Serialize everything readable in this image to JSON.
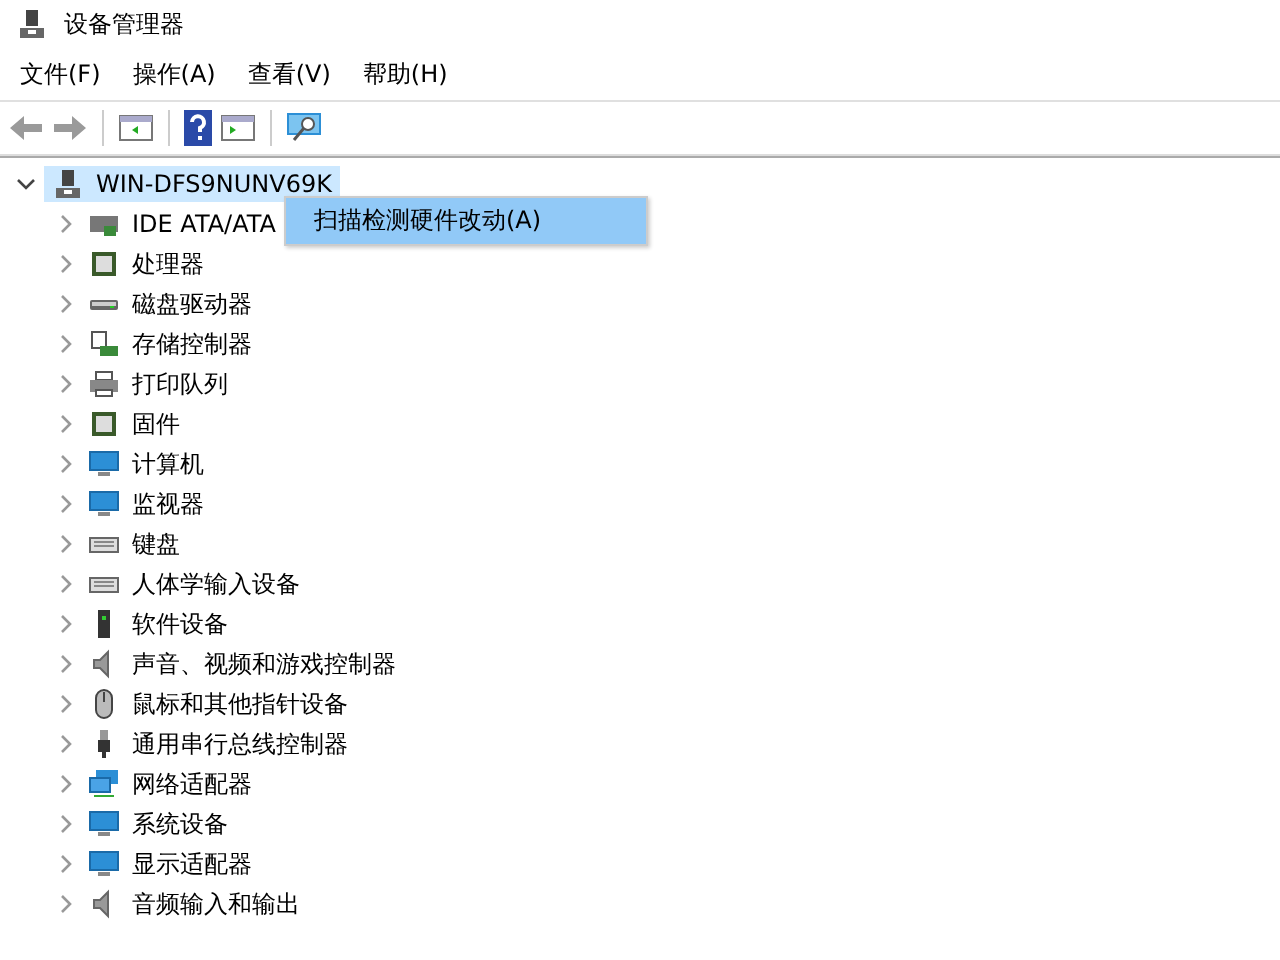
{
  "window": {
    "title": "设备管理器"
  },
  "menu": [
    "文件(F)",
    "操作(A)",
    "查看(V)",
    "帮助(H)"
  ],
  "tree": {
    "label": "WIN-DFS9NUNV69K",
    "expanded": true,
    "selected": true,
    "children": [
      {
        "label": "IDE ATA/ATA",
        "expanded": false
      },
      {
        "label": "处理器",
        "expanded": false
      },
      {
        "label": "磁盘驱动器",
        "expanded": false
      },
      {
        "label": "存储控制器",
        "expanded": false
      },
      {
        "label": "打印队列",
        "expanded": false
      },
      {
        "label": "固件",
        "expanded": false
      },
      {
        "label": "计算机",
        "expanded": false
      },
      {
        "label": "监视器",
        "expanded": false
      },
      {
        "label": "键盘",
        "expanded": false
      },
      {
        "label": "人体学输入设备",
        "expanded": false
      },
      {
        "label": "软件设备",
        "expanded": false
      },
      {
        "label": "声音、视频和游戏控制器",
        "expanded": false
      },
      {
        "label": "鼠标和其他指针设备",
        "expanded": false
      },
      {
        "label": "通用串行总线控制器",
        "expanded": false
      },
      {
        "label": "网络适配器",
        "expanded": false
      },
      {
        "label": "系统设备",
        "expanded": false
      },
      {
        "label": "显示适配器",
        "expanded": false
      },
      {
        "label": "音频输入和输出",
        "expanded": false
      }
    ]
  },
  "context_menu": {
    "items": [
      {
        "label": "扫描检测硬件改动(A)",
        "selected": true
      }
    ]
  }
}
